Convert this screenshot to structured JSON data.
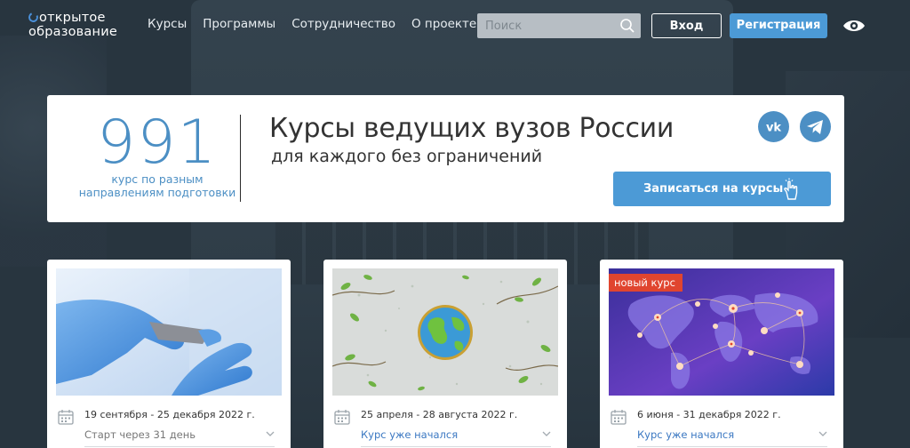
{
  "header": {
    "logo_line1": "открытое",
    "logo_line2": "образование",
    "nav": [
      "Курсы",
      "Программы",
      "Сотрудничество",
      "О проекте"
    ],
    "search_placeholder": "Поиск",
    "login_label": "Вход",
    "register_label": "Регистрация",
    "accent_color": "#4c9ad6"
  },
  "hero": {
    "count": "991",
    "count_sub_line1": "курс по разным",
    "count_sub_line2": "направлениям подготовки",
    "title": "Курсы ведущих вузов России",
    "subtitle": "для каждого без ограничений",
    "enroll_label": "Записаться на курсы",
    "social": [
      "vk-icon",
      "telegram-icon"
    ]
  },
  "cards": [
    {
      "date": "19 сентября - 25 декабря 2022 г.",
      "status": "Старт через 31 день",
      "badge": ""
    },
    {
      "date": "25 апреля - 28 августа 2022 г.",
      "status": "Курс уже начался",
      "badge": ""
    },
    {
      "date": "6 июня - 31 декабря 2022 г.",
      "status": "Курс уже начался",
      "badge": "новый курс"
    }
  ]
}
